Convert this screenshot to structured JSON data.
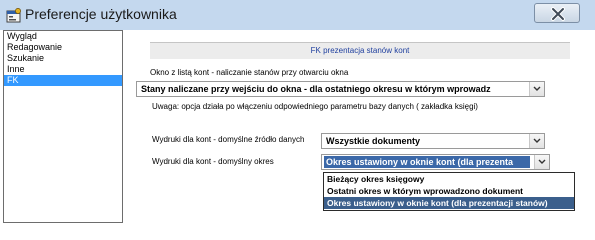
{
  "window": {
    "title": "Preferencje użytkownika"
  },
  "nav": {
    "items": [
      {
        "label": "Wygląd"
      },
      {
        "label": "Redagowanie"
      },
      {
        "label": "Szukanie"
      },
      {
        "label": "Inne"
      },
      {
        "label": "FK"
      }
    ],
    "selected": "FK"
  },
  "pane": {
    "section_title": "FK prezentacja stanów kont",
    "opening_label": "Okno z listą kont - naliczanie stanów przy otwarciu okna",
    "opening_value": "Stany naliczane przy wejściu do okna - dla ostatniego okresu w którym wprowadz",
    "note": "Uwaga: opcja działa po włączeniu odpowiedniego parametru bazy danych ( zakładka księgi)",
    "source_label": "Wydruki dla kont - domyślne źródło danych",
    "source_value": "Wszystkie dokumenty",
    "period_label": "Wydruki dla kont - domyślny okres",
    "period_value": "Okres ustawiony w oknie kont (dla prezenta"
  },
  "period_dropdown": {
    "options": [
      {
        "label": "Bieżący okres księgowy"
      },
      {
        "label": "Ostatni okres w którym wprowadzono dokument"
      },
      {
        "label": "Okres ustawiony w oknie kont (dla prezentacji stanów)"
      }
    ],
    "selected_index": 2
  },
  "colors": {
    "titlebar": "#c4d8ee",
    "selection": "#3399ff",
    "dropdown_selection": "#3b5f8c",
    "section_text": "#1f3f9e"
  },
  "icons": {
    "app": "preferences-window-icon",
    "close": "close-icon",
    "combo": "chevron-down-icon"
  }
}
